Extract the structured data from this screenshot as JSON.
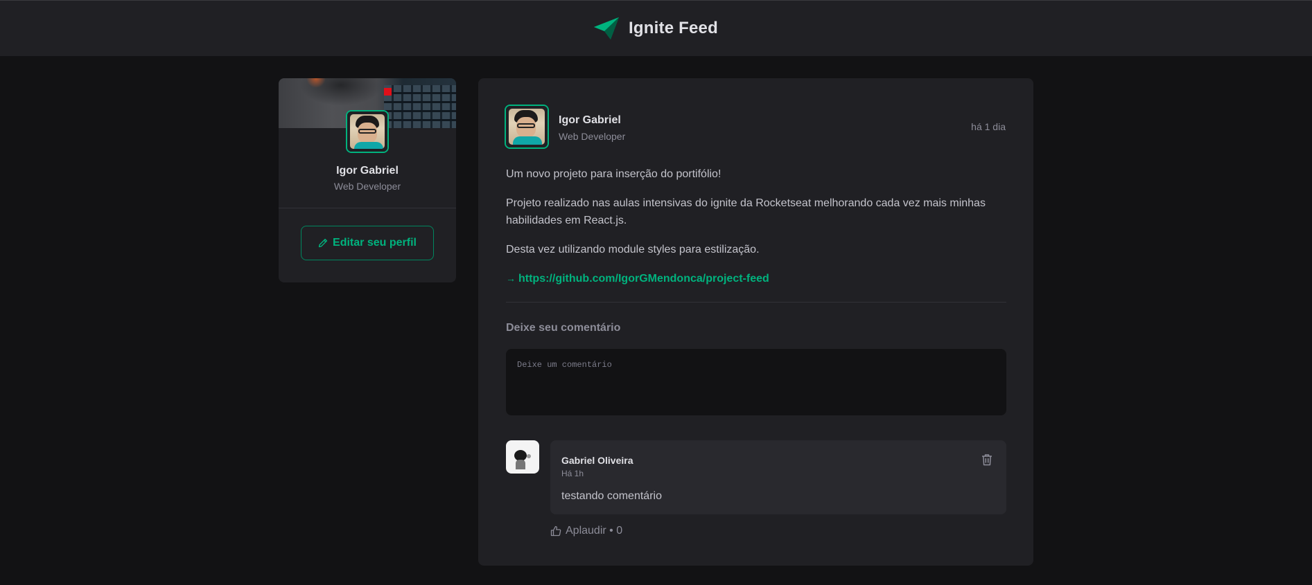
{
  "app": {
    "title": "Ignite Feed",
    "accent_color": "#00b37e",
    "logo_icon": "paper-plane-logo-icon"
  },
  "sidebar": {
    "profile": {
      "name": "Igor Gabriel",
      "role": "Web Developer",
      "avatar_icon": "user-avatar"
    },
    "edit_button_label": "Editar seu perfil",
    "edit_icon": "pencil-icon"
  },
  "post": {
    "author": {
      "name": "Igor Gabriel",
      "role": "Web Developer"
    },
    "published": "há 1 dia",
    "paragraphs": [
      "Um novo projeto para inserção do portifólio!",
      "Projeto realizado nas aulas intensivas do ignite da Rocketseat melhorando cada vez mais minhas habilidades em React.js.",
      "Desta vez utilizando module styles para estilização."
    ],
    "link": {
      "arrow": "→",
      "text": "https://github.com/IgorGMendonca/project-feed"
    },
    "comment_form": {
      "heading": "Deixe seu comentário",
      "placeholder": "Deixe um comentário"
    },
    "comments": [
      {
        "author": "Gabriel Oliveira",
        "time": "Há 1h",
        "text": "testando comentário",
        "applaud_label": "Aplaudir • 0",
        "delete_icon": "trash-icon",
        "applaud_icon": "thumbs-up-icon"
      }
    ]
  }
}
